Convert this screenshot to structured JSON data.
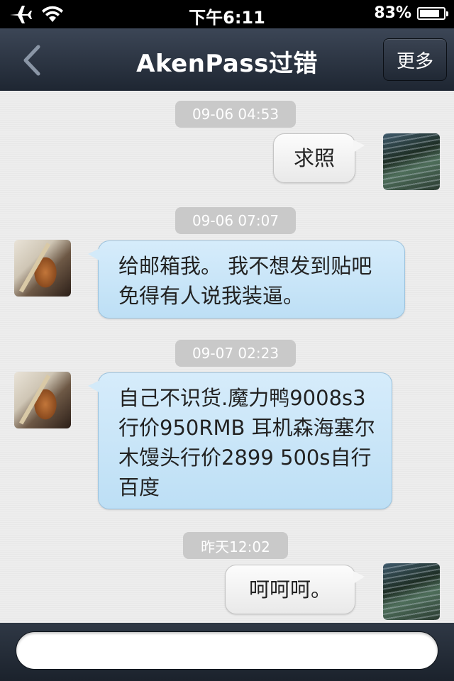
{
  "status_bar": {
    "time": "下午6:11",
    "battery_text": "83%",
    "battery_level": 0.83,
    "icons": [
      "airplane-icon",
      "wifi-icon",
      "battery-icon"
    ]
  },
  "navbar": {
    "title": "AkenPass过错",
    "more_label": "更多",
    "back_icon": "chevron-left-icon"
  },
  "messages": [
    {
      "timestamp": "09-06 04:53",
      "sender": "me",
      "text": "求照"
    },
    {
      "timestamp": "09-06 07:07",
      "sender": "other",
      "text": "给邮箱我。 我不想发到贴吧 免得有人说我装逼。"
    },
    {
      "timestamp": "09-07 02:23",
      "sender": "other",
      "text": "自己不识货.魔力鸭9008s3 行价950RMB 耳机森海塞尔木馒头行价2899 500s自行百度"
    },
    {
      "timestamp": "昨天12:02",
      "sender": "me",
      "text": "呵呵呵。"
    }
  ],
  "input": {
    "value": "",
    "placeholder": ""
  },
  "colors": {
    "navbar": "#2b3441",
    "incoming_bubble": "#c9e5f8",
    "outgoing_bubble": "#f2f2f2",
    "timestamp_pill": "#c9c9c9"
  }
}
